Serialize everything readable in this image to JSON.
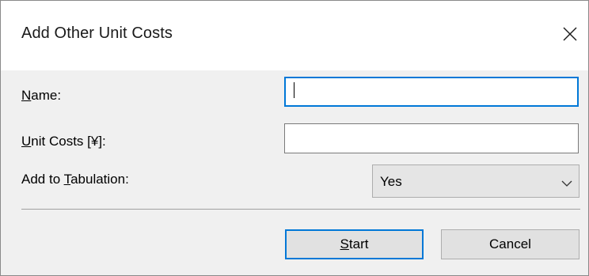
{
  "dialog": {
    "title": "Add Other Unit Costs",
    "close_icon": "close-icon"
  },
  "form": {
    "name": {
      "label_mnemonic": "N",
      "label_rest": "ame:",
      "value": ""
    },
    "unit_costs": {
      "label_mnemonic": "U",
      "label_rest": "nit Costs [¥]:",
      "value": ""
    },
    "tabulation": {
      "label_prefix": "Add to ",
      "label_mnemonic": "T",
      "label_rest": "abulation:",
      "selected": "Yes",
      "arrow_icon": "chevron-down-icon"
    }
  },
  "buttons": {
    "start_mnemonic": "S",
    "start_rest": "tart",
    "cancel": "Cancel"
  },
  "colors": {
    "focus_accent": "#0078d7",
    "dialog_background": "#f0f0f0",
    "titlebar_background": "#ffffff",
    "button_face": "#e1e1e1"
  }
}
